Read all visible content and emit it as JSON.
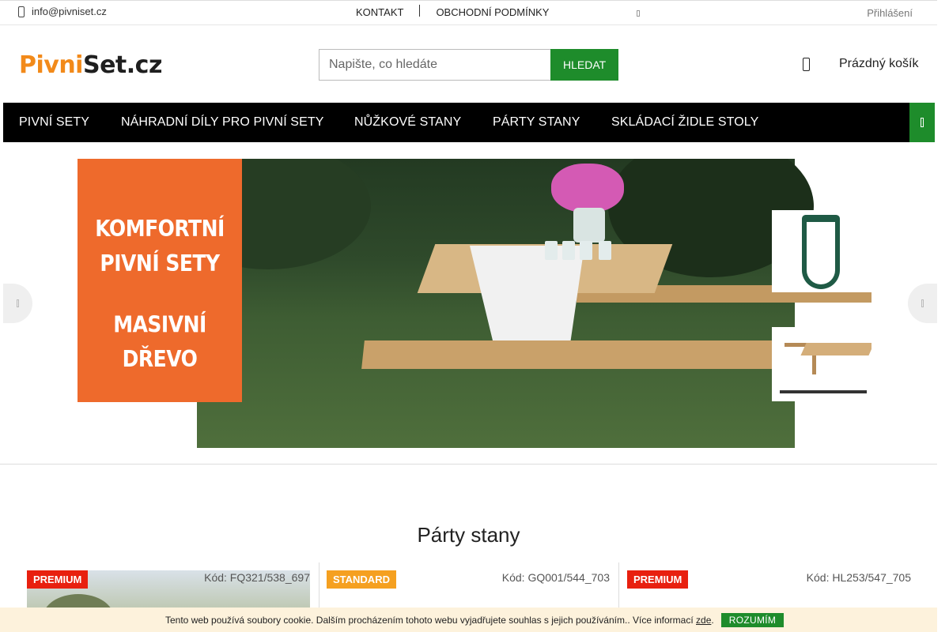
{
  "topbar": {
    "email": "info@pivniset.cz",
    "links": [
      "KONTAKT",
      "OBCHODNÍ PODMÍNKY"
    ],
    "login": "Přihlášení"
  },
  "header": {
    "logo_part1": "Pivni",
    "logo_part2": "Set.cz",
    "search_placeholder": "Napište, co hledáte",
    "search_value": "",
    "search_button": "HLEDAT",
    "cart_label": "Prázdný košík"
  },
  "nav": {
    "items": [
      "PIVNÍ SETY",
      "NÁHRADNÍ DÍLY PRO PIVNÍ SETY",
      "NŮŽKOVÉ STANY",
      "PÁRTY STANY",
      "SKLÁDACÍ ŽIDLE STOLY"
    ]
  },
  "banner": {
    "lines": [
      "KOMFORTNÍ",
      "PIVNÍ SETY",
      "MASIVNÍ DŘEVO"
    ],
    "colors": {
      "accent": "#ee6a2c"
    }
  },
  "section": {
    "title": "Párty stany",
    "products": [
      {
        "badge": "PREMIUM",
        "code": "Kód: FQ321/538_697"
      },
      {
        "badge": "STANDARD",
        "code": "Kód: GQ001/544_703"
      },
      {
        "badge": "PREMIUM",
        "code": "Kód: HL253/547_705"
      }
    ]
  },
  "cookie": {
    "text_before": "Tento web používá soubory cookie. Dalším procházením tohoto webu vyjadřujete souhlas s jejich používáním.. Více informací ",
    "link": "zde",
    "text_after": ".",
    "button": "ROZUMÍM"
  },
  "theme": {
    "brand_green": "#1e8c2b",
    "brand_orange": "#f28a1a",
    "badge_premium": "#e8200f",
    "badge_standard": "#f5a020"
  }
}
